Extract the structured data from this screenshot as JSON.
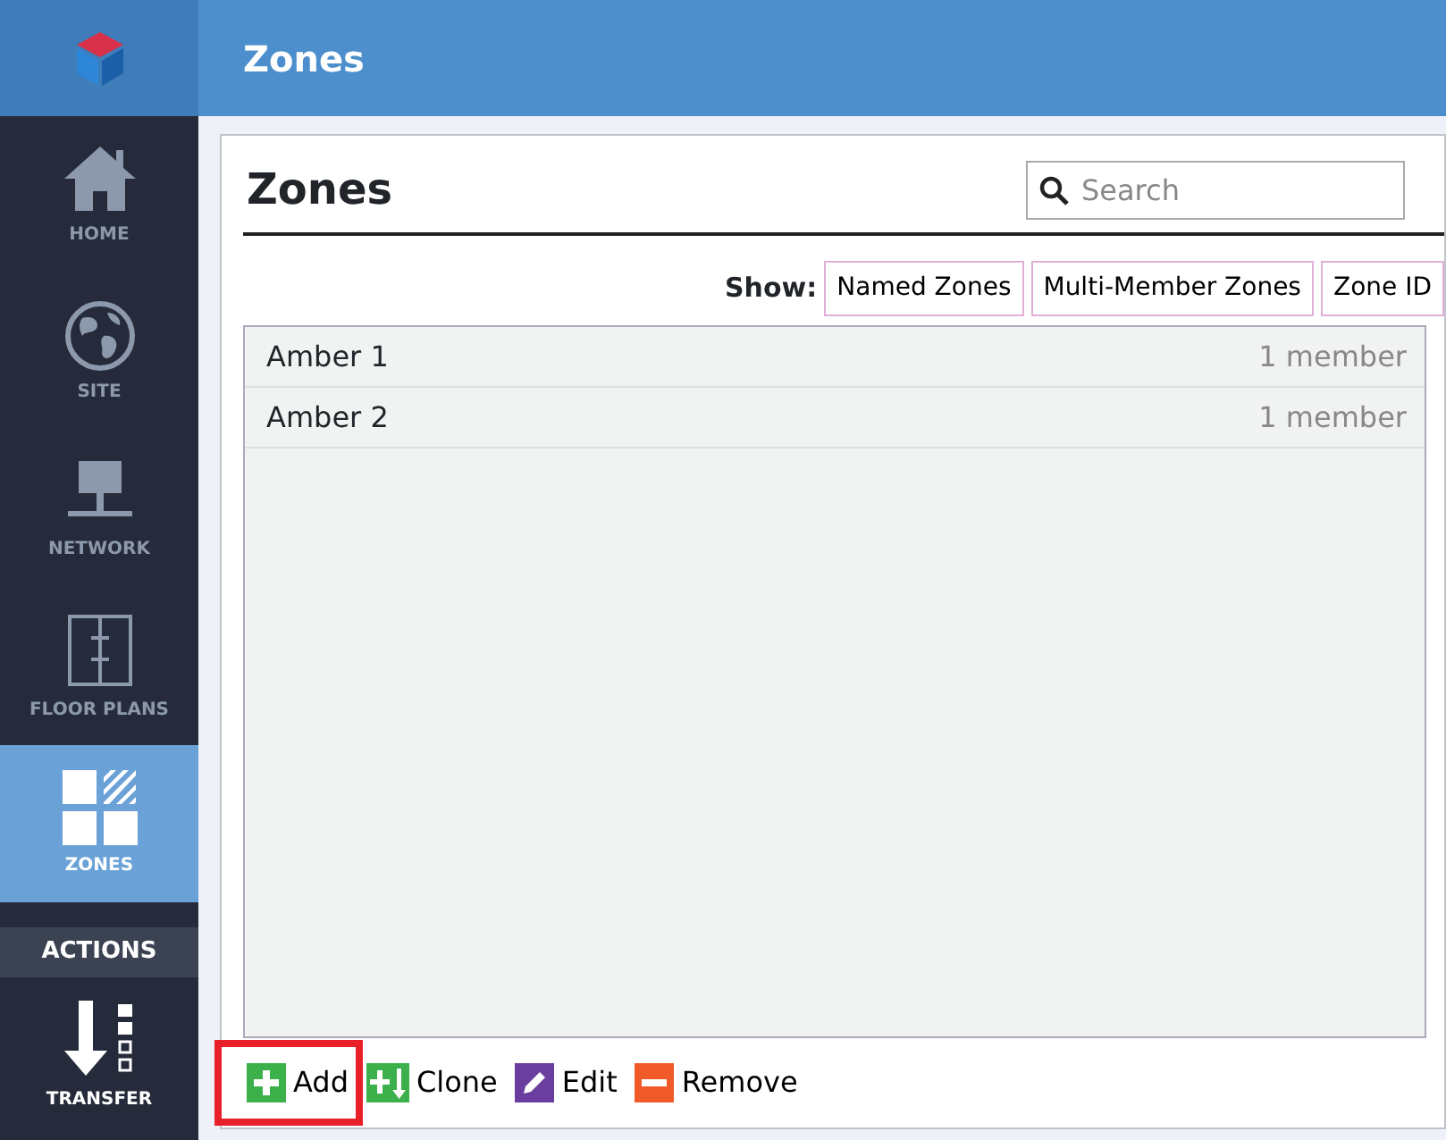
{
  "header": {
    "title": "Zones"
  },
  "sidebar": {
    "items": [
      {
        "label": "HOME",
        "kind": "home",
        "selected": false
      },
      {
        "label": "SITE",
        "kind": "site",
        "selected": false
      },
      {
        "label": "NETWORK",
        "kind": "network",
        "selected": false
      },
      {
        "label": "FLOOR PLANS",
        "kind": "floorplans",
        "selected": false
      },
      {
        "label": "ZONES",
        "kind": "zones",
        "selected": true
      }
    ],
    "section": "ACTIONS",
    "actions": [
      {
        "label": "TRANSFER",
        "kind": "transfer"
      }
    ]
  },
  "panel": {
    "title": "Zones",
    "search": {
      "placeholder": "Search"
    },
    "show_label": "Show:",
    "filters": [
      "Named Zones",
      "Multi-Member Zones",
      "Zone ID"
    ],
    "rows": [
      {
        "name": "Amber 1",
        "members": "1 member"
      },
      {
        "name": "Amber 2",
        "members": "1 member"
      }
    ],
    "toolbar": [
      {
        "label": "Add",
        "kind": "add",
        "highlighted": true
      },
      {
        "label": "Clone",
        "kind": "clone",
        "highlighted": false
      },
      {
        "label": "Edit",
        "kind": "edit",
        "highlighted": false
      },
      {
        "label": "Remove",
        "kind": "remove",
        "highlighted": false
      }
    ]
  }
}
